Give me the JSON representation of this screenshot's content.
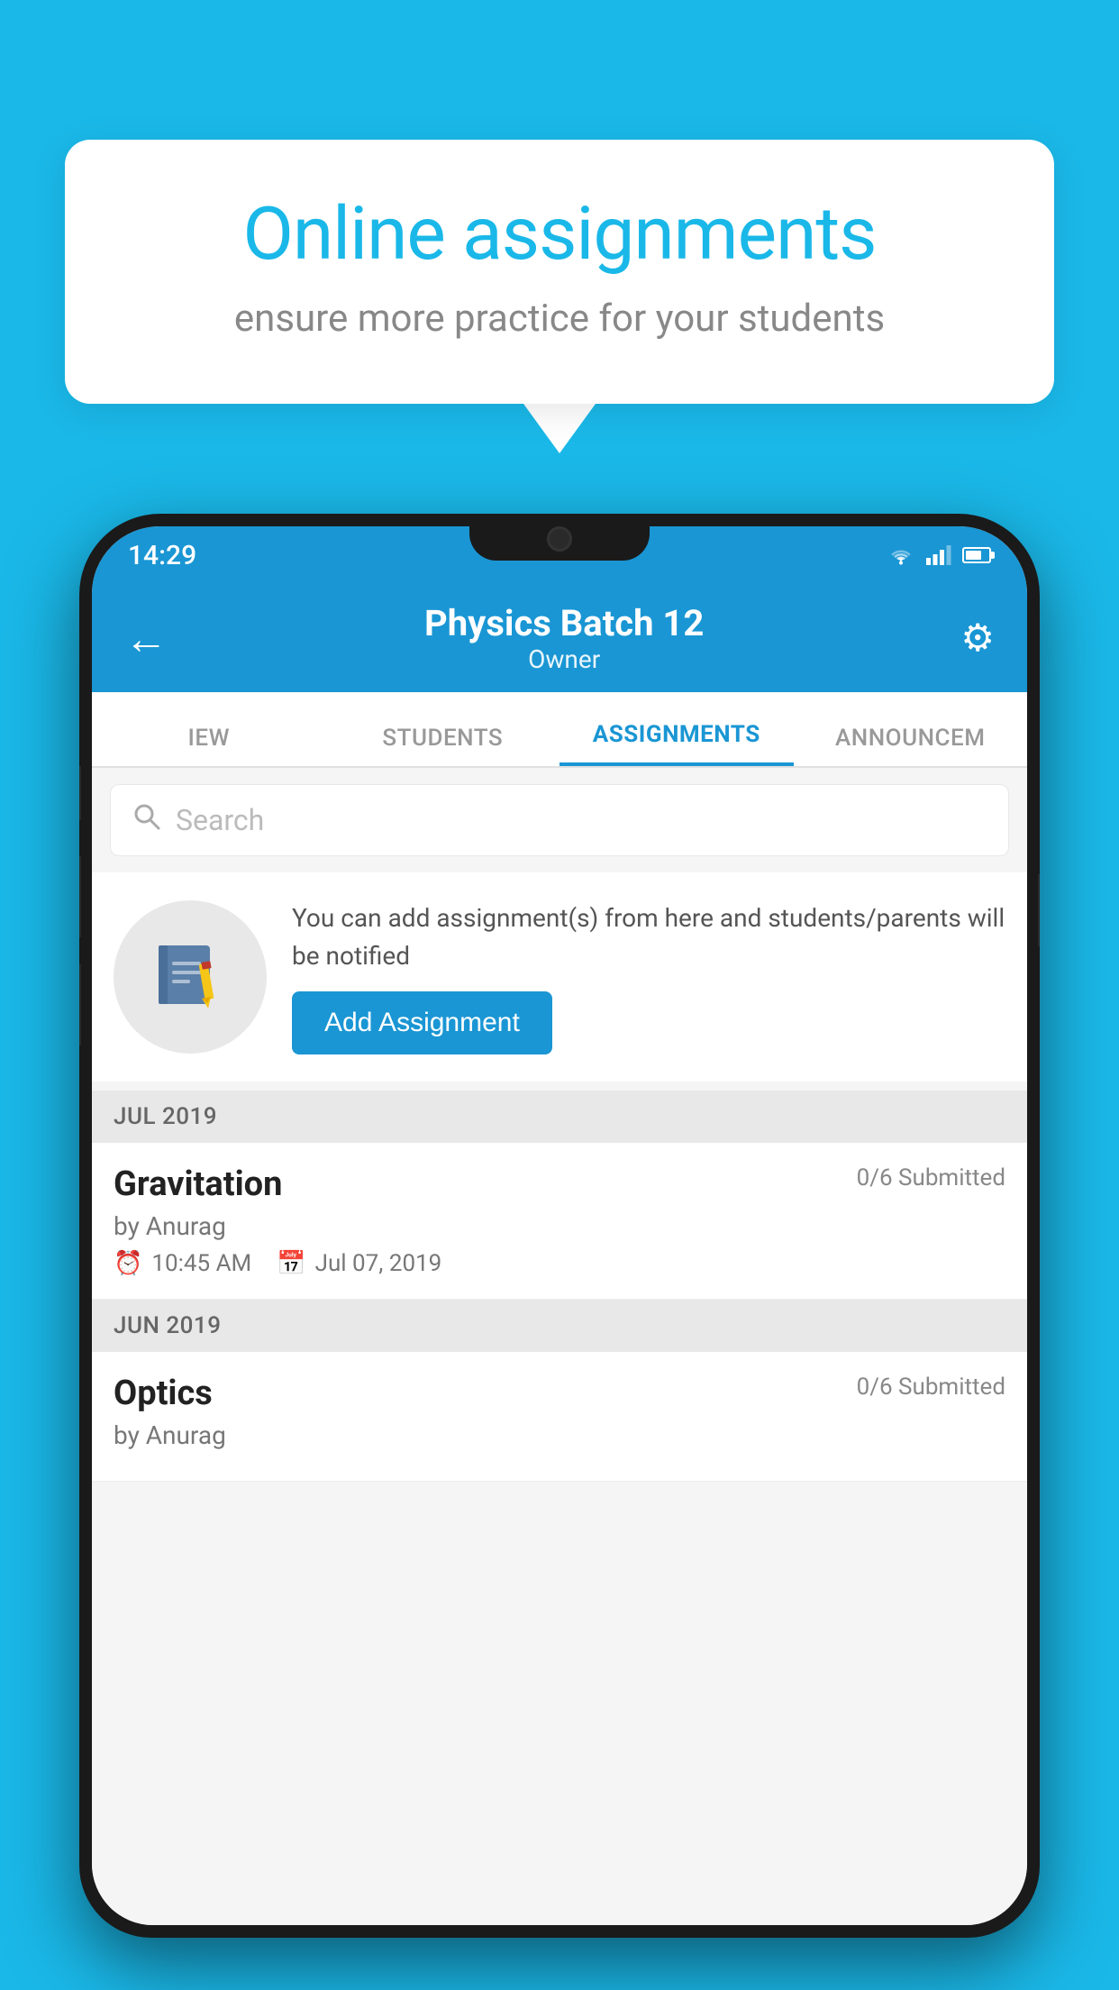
{
  "background_color": "#1ab8e8",
  "speech_bubble": {
    "title": "Online assignments",
    "subtitle": "ensure more practice for your students"
  },
  "phone": {
    "status_bar": {
      "time": "14:29",
      "icons": [
        "wifi",
        "signal",
        "battery"
      ]
    },
    "header": {
      "back_label": "←",
      "title": "Physics Batch 12",
      "subtitle": "Owner",
      "settings_label": "⚙"
    },
    "tabs": [
      {
        "label": "IEW",
        "active": false
      },
      {
        "label": "STUDENTS",
        "active": false
      },
      {
        "label": "ASSIGNMENTS",
        "active": true
      },
      {
        "label": "ANNOUNCEM",
        "active": false
      }
    ],
    "search": {
      "placeholder": "Search"
    },
    "add_promo": {
      "description": "You can add assignment(s) from here and students/parents will be notified",
      "button_label": "Add Assignment"
    },
    "sections": [
      {
        "label": "JUL 2019",
        "assignments": [
          {
            "name": "Gravitation",
            "submitted": "0/6 Submitted",
            "by": "by Anurag",
            "time": "10:45 AM",
            "date": "Jul 07, 2019"
          }
        ]
      },
      {
        "label": "JUN 2019",
        "assignments": [
          {
            "name": "Optics",
            "submitted": "0/6 Submitted",
            "by": "by Anurag",
            "time": "",
            "date": ""
          }
        ]
      }
    ]
  }
}
